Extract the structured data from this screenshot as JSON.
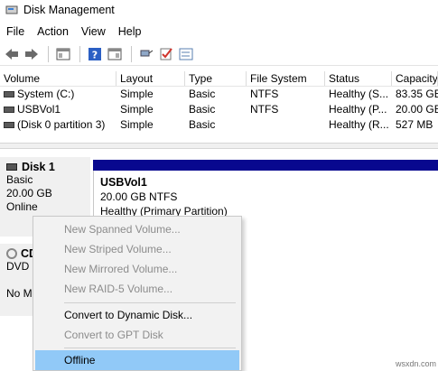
{
  "window": {
    "title": "Disk Management"
  },
  "menu": [
    "File",
    "Action",
    "View",
    "Help"
  ],
  "toolbar": [
    "back-icon",
    "forward-icon",
    "console-tree-icon",
    "help-icon",
    "show-hide-icon",
    "connect-icon",
    "checkmark-icon",
    "properties-icon"
  ],
  "volume_table": {
    "columns": [
      "Volume",
      "Layout",
      "Type",
      "File System",
      "Status",
      "Capacity"
    ],
    "rows": [
      {
        "volume": "System (C:)",
        "layout": "Simple",
        "type": "Basic",
        "fs": "NTFS",
        "status": "Healthy (S...",
        "capacity": "83.35 GB"
      },
      {
        "volume": "USBVol1",
        "layout": "Simple",
        "type": "Basic",
        "fs": "NTFS",
        "status": "Healthy (P...",
        "capacity": "20.00 GB"
      },
      {
        "volume": "(Disk 0 partition 3)",
        "layout": "Simple",
        "type": "Basic",
        "fs": "",
        "status": "Healthy (R...",
        "capacity": "527 MB"
      }
    ]
  },
  "disk1": {
    "name": "Disk 1",
    "type": "Basic",
    "size": "20.00 GB",
    "state": "Online"
  },
  "volume_box": {
    "name": "USBVol1",
    "size_fs": "20.00 GB NTFS",
    "status": "Healthy (Primary Partition)"
  },
  "cd": {
    "name": "CD",
    "type": "DVD (",
    "media": "No M"
  },
  "context_menu": {
    "items": [
      {
        "label": "New Spanned Volume...",
        "enabled": false
      },
      {
        "label": "New Striped Volume...",
        "enabled": false
      },
      {
        "label": "New Mirrored Volume...",
        "enabled": false
      },
      {
        "label": "New RAID-5 Volume...",
        "enabled": false
      },
      {
        "label": "Convert to Dynamic Disk...",
        "enabled": true
      },
      {
        "label": "Convert to GPT Disk",
        "enabled": false
      },
      {
        "label": "Offline",
        "enabled": true,
        "highlighted": true
      }
    ]
  },
  "watermark": "wsxdn.com",
  "colors": {
    "volume_bar": "#08088f",
    "highlight": "#91c9f7"
  }
}
